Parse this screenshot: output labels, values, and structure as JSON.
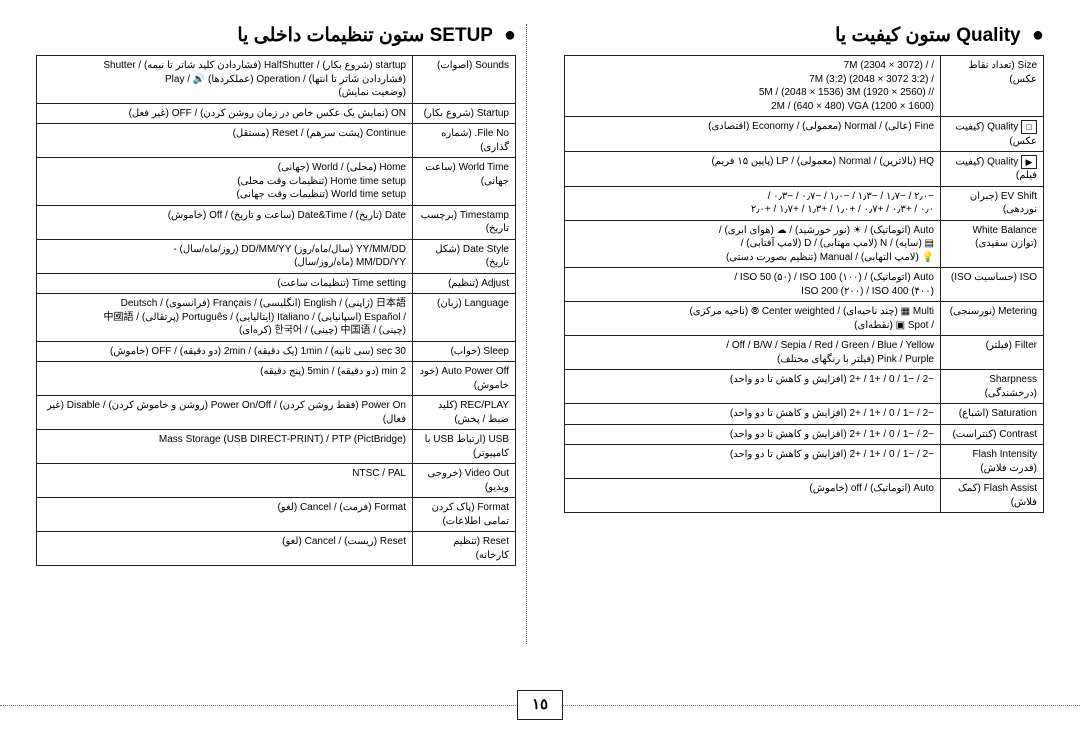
{
  "page_number": "١٥",
  "right": {
    "title": "ستون کیفیت یا Quality",
    "rows": [
      {
        "label": "Size (تعداد نقاط عکس)",
        "val": "/ / (3072 × 2304) 7M\n/ (3:2 3072 × 2048) (3:2) 7M\n// (2560 × 1920) 5M / (2048 × 1536) 3M\n(1600 × 1200) 2M / (640 × 480) VGA"
      },
      {
        "label": "Quality (کیفیت عکس)",
        "val": "Fine (عالی) / Normal (معمولی) / Economy (اقتصادی)",
        "icon": "□"
      },
      {
        "label": "Quality (کیفیت فیلم)",
        "val": "HQ (بالاترین) / Normal (معمولی) / LP (پایین ۱۵ فریم)",
        "icon": "▶"
      },
      {
        "label": "EV Shift (جبران نوردهی)",
        "val": "−۲٫۰ / −۱٫۷ / −۱٫۳ / −۱٫۰ / −۰٫۷ / −۰٫۳ /\n۰٫۰ / +۰٫۳ / +۰٫۷ / +۱٫۰ / +۱٫۳ / +۱٫۷ / +۲٫۰"
      },
      {
        "label": "White Balance (توازن سفیدی)",
        "val": "Auto (اتوماتیک) / ☀ (نور خورشید) / ☁ (هوای ابری) / \n▤ (سایه) / N (لامپ مهتابی) / D (لامپ آفتابی) / \n💡 (لامپ التهابی) / Manual (تنظیم بصورت دستی)"
      },
      {
        "label": "ISO (حساسیت ISO)",
        "val": "Auto (اتوماتیک) / ISO 50 (۵۰) / ISO 100 (۱۰۰) /\nISO 200 (۲۰۰) / ISO 400 (۴۰۰)"
      },
      {
        "label": "Metering (نورسنجی)",
        "val": "Multi ▦ (چند ناحیه‌ای) / Center weighted ⦾ (ناحیه مرکزی)\n/ Spot ▣ (نقطه‌ای)"
      },
      {
        "label": "Filter (فیلتر)",
        "val": "Off / B/W / Sepia / Red / Green / Blue / Yellow /\nPink / Purple (فیلتر با رنگهای مختلف)"
      },
      {
        "label": "Sharpness (درخشندگی)",
        "val": "−2 / −1 / 0 / +1 / +2 (افزایش و کاهش تا دو واحد)"
      },
      {
        "label": "Saturation (اشباع)",
        "val": "−2 / −1 / 0 / +1 / +2 (افزایش و کاهش تا دو واحد)"
      },
      {
        "label": "Contrast (کنتراست)",
        "val": "−2 / −1 / 0 / +1 / +2 (افزایش و کاهش تا دو واحد)"
      },
      {
        "label": "Flash Intensity (قدرت فلاش)",
        "val": "−2 / −1 / 0 / +1 / +2 (افزایش و کاهش تا دو واحد)"
      },
      {
        "label": "Flash Assist (کمک فلاش)",
        "val": "Auto (اتوماتیک) / off (خاموش)"
      }
    ]
  },
  "left": {
    "title": "ستون تنظیمات داخلی یا SETUP",
    "rows": [
      {
        "label": "Sounds (اصوات)",
        "val": "startup (شروع بکار) / HalfShutter (فشاردادن کلید شاتر تا نیمه) / Shutter\n(فشاردادن شاتر تا انتها) / Operation (عملکردها) 🔊 / Play\n(وضعیت نمایش)"
      },
      {
        "label": "Startup (شروع بکار)",
        "val": "ON (نمایش یک عکس خاص در زمان روشن کردن) / OFF (غیر فعل)"
      },
      {
        "label": "File No. (شماره گذاری)",
        "val": "Continue (پشت سرهم) / Reset (مستقل)"
      },
      {
        "label": "World Time (ساعت جهانی)",
        "val": "Home (محلی) / World (جهانی)\nHome time setup (تنظیمات وقت محلی)\nWorld time setup (تنظیمات وقت جهانی)"
      },
      {
        "label": "Timestamp (برچسب تاریخ)",
        "val": "Date (تاریخ) / Date&Time (ساعت و تاریخ) / Off (خاموش)"
      },
      {
        "label": "Date Style (شکل تاریخ)",
        "val": "YY/MM/DD (سال/ماه/روز) DD/MM/YY (روز/ماه/سال) -\nMM/DD/YY (ماه/روز/سال)"
      },
      {
        "label": "Adjust (تنظیم)",
        "val": "Time setting (تنظیمات ساعت)"
      },
      {
        "label": "Language (زبان)",
        "val": "日本語 (ژاپنی) / English (انگلیسی) / Français (فرانسوی) / Deutsch\n/ Español (اسپانیایی) / Italiano (ایتالیایی) / Português (پرتقالی) / 中國語\n(چینی) / 中国语 (چینی) / 한국어 (کره‌ای)"
      },
      {
        "label": "Sleep (خواب)",
        "val": "30 sec (سی ثانیه) / 1min (یک دقیقه) / 2min (دو دقیقه) / OFF (خاموش)"
      },
      {
        "label": "Auto Power Off (خود خاموش)",
        "val": "2 min (دو دقیقه) / 5min (پنج دقیقه)"
      },
      {
        "label": "REC/PLAY (کلید ضبط / پخش)",
        "val": "Power On (فقط روشن کردن) / Power On/Off (روشن و خاموش کردن) / Disable (غیر فعال)"
      },
      {
        "label": "USB (ارتباط USB با کامپیوتر)",
        "val": "Mass Storage (USB DIRECT-PRINT) / PTP (PictBridge)"
      },
      {
        "label": "Video Out (خروجی ویدیو)",
        "val": "NTSC / PAL"
      },
      {
        "label": "Format (پاک کردن تمامی اطلاعات)",
        "val": "Format (فرمت) / Cancel (لغو)"
      },
      {
        "label": "Reset (تنظیم کارخانه)",
        "val": "Reset (ریست) / Cancel (لغو)"
      }
    ]
  }
}
